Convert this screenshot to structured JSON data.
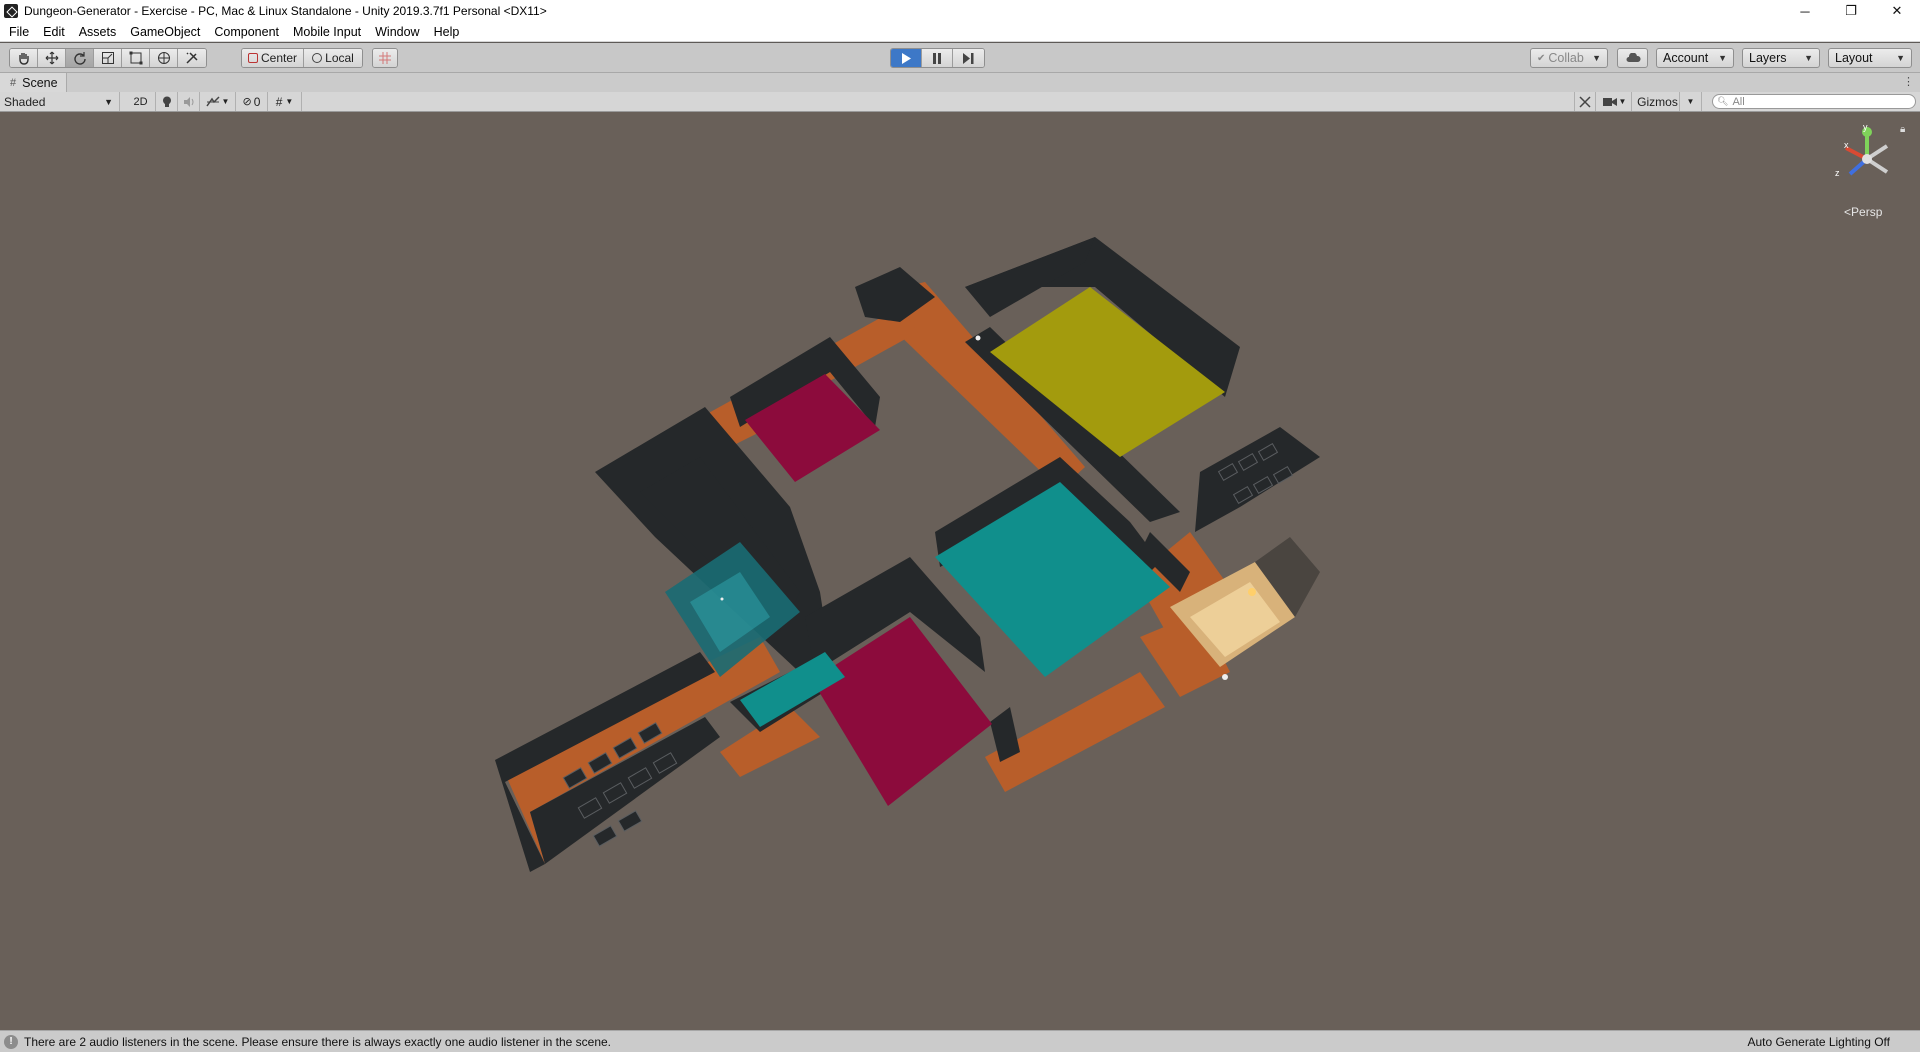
{
  "window": {
    "title": "Dungeon-Generator - Exercise - PC, Mac & Linux Standalone - Unity 2019.3.7f1 Personal <DX11>",
    "controls": [
      "─",
      "❐",
      "✕"
    ]
  },
  "menu": [
    "File",
    "Edit",
    "Assets",
    "GameObject",
    "Component",
    "Mobile Input",
    "Window",
    "Help"
  ],
  "toolbar": {
    "pivot_label": "Center",
    "space_label": "Local",
    "collab_label": "Collab",
    "account_label": "Account",
    "layers_label": "Layers",
    "layout_label": "Layout"
  },
  "scene": {
    "tab_label": "Scene",
    "draw_mode": "Shaded",
    "mode_2d": "2D",
    "hidden_count": "0",
    "gizmos_label": "Gizmos",
    "search_placeholder": "All",
    "projection_label": "Persp",
    "gizmo_axes": {
      "x": "x",
      "y": "y",
      "z": "z"
    }
  },
  "status": {
    "message": "There are 2 audio listeners in the scene. Please ensure there is always exactly one audio listener in the scene.",
    "lighting": "Auto Generate Lighting Off"
  },
  "colors": {
    "viewport_bg": "#696059",
    "corridor": "#b85e2a",
    "wall": "#25282a",
    "room_yellow": "#a39b0d",
    "room_teal": "#108f8c",
    "room_magenta": "#8c0b3c",
    "room_magenta_2": "#b0124a"
  }
}
